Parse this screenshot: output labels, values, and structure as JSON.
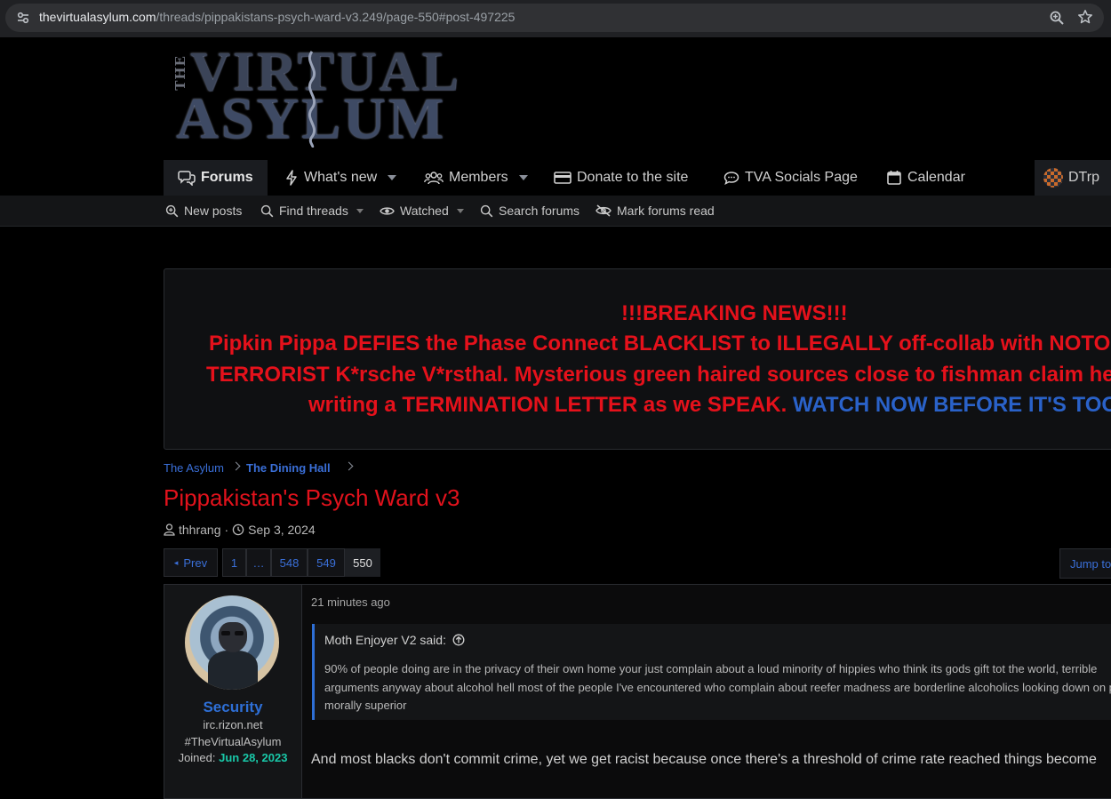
{
  "browser": {
    "url_host": "thevirtualasylum.com",
    "url_path": "/threads/pippakistans-psych-ward-v3.249/page-550#post-497225"
  },
  "logo": {
    "line_the": "THE",
    "line1": "VIRTUAL",
    "line2": "ASYLUM"
  },
  "nav": {
    "forums": "Forums",
    "whats_new": "What's new",
    "members": "Members",
    "donate": "Donate to the site",
    "socials": "TVA Socials Page",
    "calendar": "Calendar",
    "user": "DTrp"
  },
  "subnav": {
    "new_posts": "New posts",
    "find_threads": "Find threads",
    "watched": "Watched",
    "search_forums": "Search forums",
    "mark_read": "Mark forums read"
  },
  "notice": {
    "line1": "!!!BREAKING NEWS!!!",
    "line2": "Pipkin Pippa DEFIES the Phase Connect BLACKLIST to ILLEGALLY off-collab with NOTORIOUS",
    "line3": "TERRORIST K*rsche V*rsthal. Mysterious green haired sources close to fishman claim he is",
    "line4": "writing a TERMINATION LETTER as we SPEAK. ",
    "line4_link": "WATCH NOW BEFORE IT'S TOO LATE"
  },
  "breadcrumb": {
    "item1": "The Asylum",
    "item2": "The Dining Hall"
  },
  "thread": {
    "title": "Pippakistan's Psych Ward v3",
    "author": "thhrang",
    "date": "Sep 3, 2024"
  },
  "pagination": {
    "prev": "Prev",
    "pages": [
      "1",
      "…",
      "548",
      "549",
      "550"
    ],
    "current": "550",
    "jump": "Jump to"
  },
  "post": {
    "username": "Security",
    "user_line1": "irc.rizon.net",
    "user_line2": "#TheVirtualAsylum",
    "joined_label": "Joined:",
    "joined_date": "Jun 28, 2023",
    "time": "21 minutes ago",
    "quote_author": "Moth Enjoyer V2 said:",
    "quote_line1": "90% of people doing are in the privacy of their own home your just complain about a loud minority of hippies who think its gods gift tot the world, terrible",
    "quote_line2": "arguments anyway about alcohol hell most of the people I've encountered who complain about reefer madness are borderline alcoholics looking down on people as",
    "quote_line3": "morally superior",
    "text": "And most blacks don't commit crime, yet we get racist because once there's a threshold of crime rate reached things become"
  },
  "colors": {
    "accent_blue": "#2e6fd6",
    "alert_red": "#e5111b",
    "joined_teal": "#19c8a8"
  },
  "icons": [
    "tune-icon",
    "zoom-icon",
    "star-icon",
    "forums-icon",
    "bolt-icon",
    "members-icon",
    "card-icon",
    "chat-icon",
    "calendar-icon",
    "new-posts-icon",
    "search-icon",
    "eye-icon",
    "eye-off-icon",
    "user-icon",
    "clock-icon",
    "arrow-up-circle-icon"
  ]
}
